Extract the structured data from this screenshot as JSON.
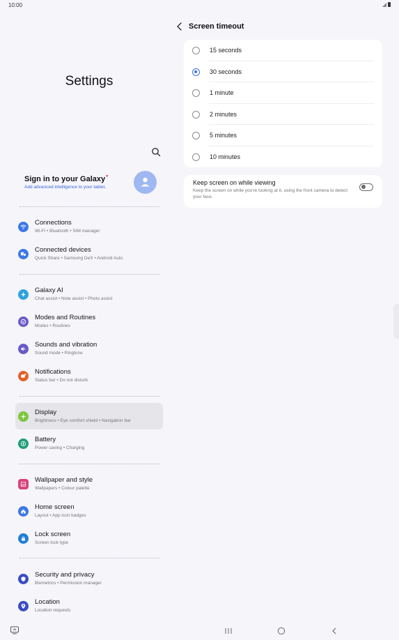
{
  "status": {
    "time": "10:00"
  },
  "left": {
    "title": "Settings",
    "account": {
      "title": "Sign in to your Galaxy",
      "badge": "•",
      "subtitle": "Add advanced intelligence to your tablet."
    },
    "items": [
      {
        "title": "Connections",
        "subtitle": "Wi-Fi  •  Bluetooth  •  SIM manager",
        "icon": "wifi-icon",
        "color": "#3d78e6"
      },
      {
        "title": "Connected devices",
        "subtitle": "Quick Share  •  Samsung DeX  •  Android Auto",
        "icon": "devices-icon",
        "color": "#3d78e6"
      },
      {
        "title": "Galaxy AI",
        "subtitle": "Chat assist  •  Note assist  •  Photo assist",
        "icon": "sparkle-icon",
        "color": "#2fa3dc"
      },
      {
        "title": "Modes and Routines",
        "subtitle": "Modes  •  Routines",
        "icon": "check-circle-icon",
        "color": "#6a5ac8"
      },
      {
        "title": "Sounds and vibration",
        "subtitle": "Sound mode  •  Ringtone",
        "icon": "speaker-icon",
        "color": "#6a5ac8"
      },
      {
        "title": "Notifications",
        "subtitle": "Status bar  •  Do not disturb",
        "icon": "bell-icon",
        "color": "#e3612b"
      },
      {
        "title": "Display",
        "subtitle": "Brightness  •  Eye comfort shield  •  Navigation bar",
        "icon": "sun-icon",
        "color": "#7cc63f"
      },
      {
        "title": "Battery",
        "subtitle": "Power saving  •  Charging",
        "icon": "battery-icon",
        "color": "#1f9e78"
      },
      {
        "title": "Wallpaper and style",
        "subtitle": "Wallpapers  •  Colour palette",
        "icon": "image-icon",
        "color": "#d8457a"
      },
      {
        "title": "Home screen",
        "subtitle": "Layout  •  App icon badges",
        "icon": "home-icon",
        "color": "#3d78e6"
      },
      {
        "title": "Lock screen",
        "subtitle": "Screen lock type",
        "icon": "lock-icon",
        "color": "#1f7fd8"
      },
      {
        "title": "Security and privacy",
        "subtitle": "Biometrics  •  Permission manager",
        "icon": "shield-icon",
        "color": "#3a4cc4"
      },
      {
        "title": "Location",
        "subtitle": "Location requests",
        "icon": "location-pin-icon",
        "color": "#3a4cc4"
      }
    ]
  },
  "right": {
    "title": "Screen timeout",
    "options": [
      {
        "label": "15 seconds",
        "selected": false
      },
      {
        "label": "30 seconds",
        "selected": true
      },
      {
        "label": "1 minute",
        "selected": false
      },
      {
        "label": "2 minutes",
        "selected": false
      },
      {
        "label": "5 minutes",
        "selected": false
      },
      {
        "label": "10 minutes",
        "selected": false
      }
    ],
    "keep": {
      "title": "Keep screen on while viewing",
      "subtitle": "Keep the screen on while you're looking at it, using the front camera to detect your face.",
      "enabled": false
    }
  }
}
